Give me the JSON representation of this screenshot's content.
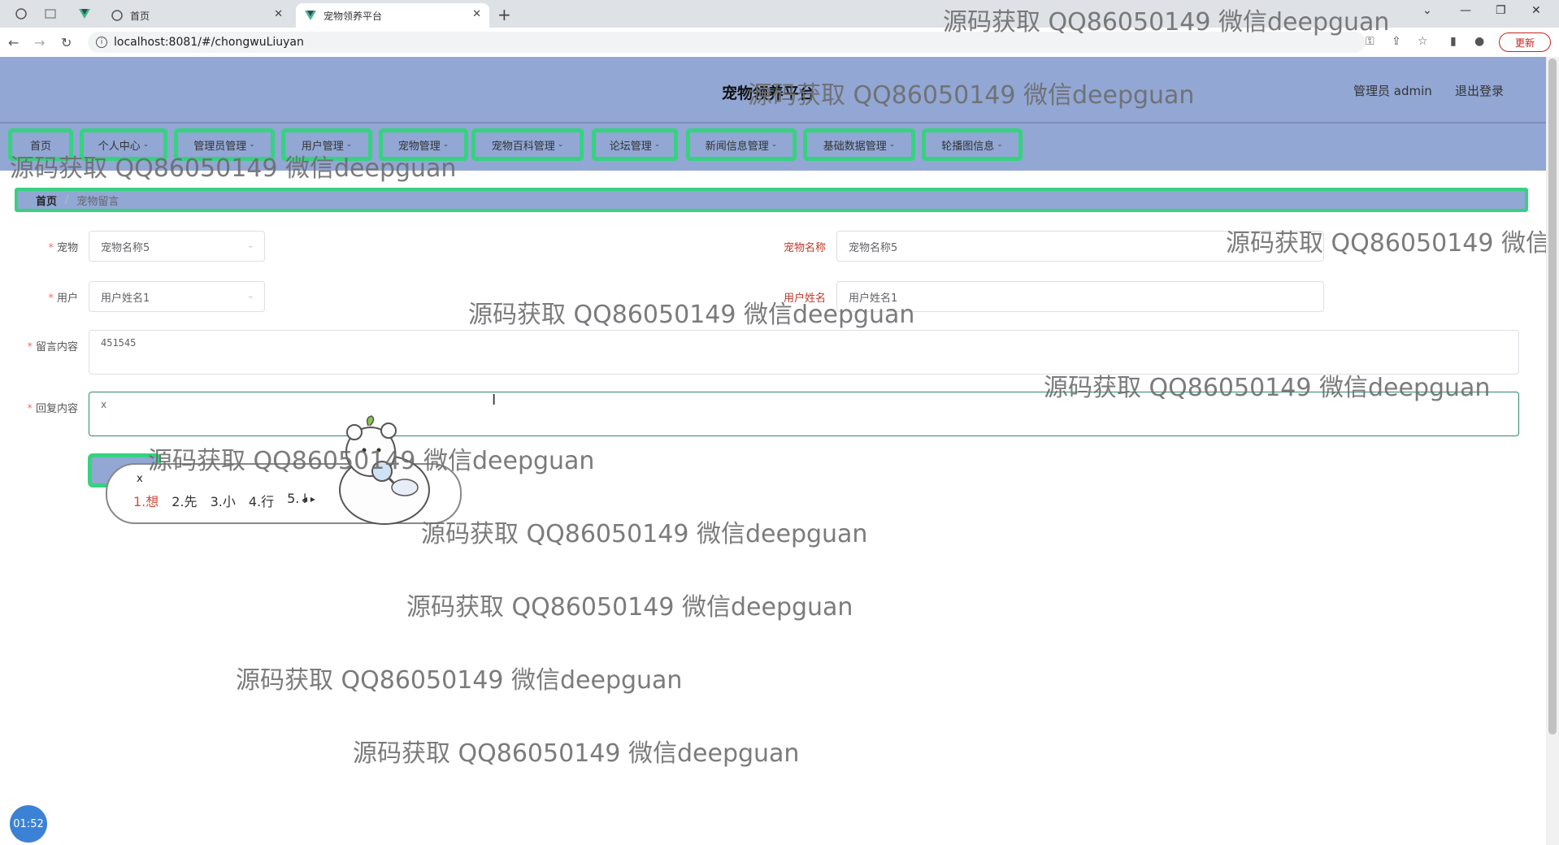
{
  "browser": {
    "tabs": [
      {
        "title": "首页"
      },
      {
        "title": "宠物领养平台"
      }
    ],
    "url": "localhost:8081/#/chongwuLiuyan",
    "update_label": "更新"
  },
  "header": {
    "title": "宠物领养平台",
    "user": "管理员 admin",
    "logout": "退出登录"
  },
  "menu": [
    "首页",
    "个人中心",
    "管理员管理",
    "用户管理",
    "宠物管理",
    "宠物百科管理",
    "论坛管理",
    "新闻信息管理",
    "基础数据管理",
    "轮播图信息"
  ],
  "breadcrumb": {
    "home": "首页",
    "current": "宠物留言"
  },
  "form": {
    "pet_label": "宠物",
    "pet_value": "宠物名称5",
    "pet_name_label": "宠物名称",
    "pet_name_value": "宠物名称5",
    "user_label": "用户",
    "user_value": "用户姓名1",
    "user_name_label": "用户姓名",
    "user_name_value": "用户姓名1",
    "message_label": "留言内容",
    "message_value": "451545",
    "reply_label": "回复内容",
    "reply_value": "x"
  },
  "ime": {
    "typed": "x",
    "candidates": [
      "1.想",
      "2.先",
      "3.小",
      "4.行",
      "5.↓"
    ]
  },
  "watermark": "源码获取 QQ86050149 微信deepguan",
  "timer": "01:52"
}
